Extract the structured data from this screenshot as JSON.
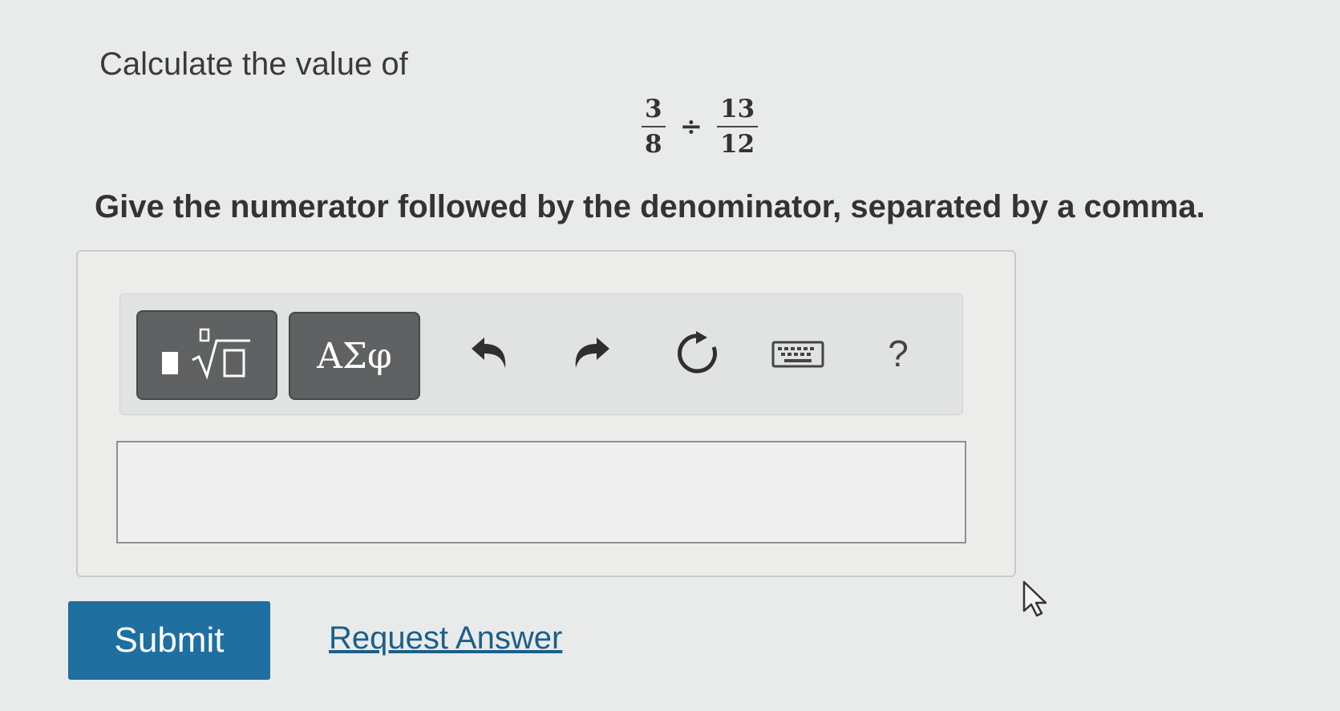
{
  "question": {
    "prompt": "Calculate the value of",
    "expression": {
      "left_numerator": "3",
      "left_denominator": "8",
      "operator": "÷",
      "right_numerator": "13",
      "right_denominator": "12"
    },
    "instruction": "Give the numerator followed by the denominator, separated by a comma."
  },
  "toolbar": {
    "symbols_label": "ΑΣφ",
    "help_label": "?",
    "icons": [
      "templates-icon",
      "undo-icon",
      "redo-icon",
      "reset-icon",
      "keyboard-icon"
    ]
  },
  "answer": {
    "value": ""
  },
  "actions": {
    "submit_label": "Submit",
    "request_answer_label": "Request Answer"
  },
  "colors": {
    "submit_bg": "#1f6fa0",
    "link": "#1b5f8a",
    "toolbar_button": "#5f6163"
  }
}
